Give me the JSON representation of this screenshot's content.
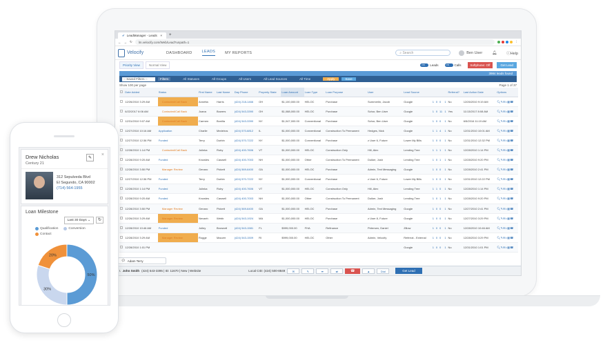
{
  "browser": {
    "tab_title": "LeadManager - Leads",
    "url": "lm.velocify.com/Web/Lead?unpath=1"
  },
  "app": {
    "logo": "Velocify",
    "nav": [
      {
        "label": "DASHBOARD"
      },
      {
        "label": "LEADS"
      },
      {
        "label": "MY REPORTS"
      }
    ],
    "search_placeholder": "Search",
    "user": "Ben User",
    "help": "Help"
  },
  "toolbar": {
    "priority_view": "Priority View",
    "normal_view": "Normal View",
    "leads_toggle": "Leads",
    "calls_toggle": "Calls",
    "softphone": "Softphone: Off",
    "get_lead": "Get Lead"
  },
  "banner": {
    "text": "3984 leads found"
  },
  "filters": {
    "saved": "-- Saved Filters --",
    "filter_btn": "Filters",
    "items": [
      "All Statuses",
      "All Groups",
      "All Users",
      "All Lead Sources",
      "All Time"
    ],
    "apply": "Apply",
    "save": "Save"
  },
  "meta": {
    "show": "Show 100 per page",
    "page": "Page 1 of 37"
  },
  "table": {
    "headers": [
      "Date Added",
      "Status",
      "First Name",
      "Last Name",
      "Day Phone",
      "Property State",
      "Loan Amount",
      "Loan Type",
      "Loan Purpose",
      "User",
      "Lead Source",
      "",
      "",
      "",
      "",
      "Referral?",
      "Last Action Date",
      "Options"
    ],
    "rows": [
      [
        "12/26/2010 3:29 AM",
        "Contacted/Call Back",
        "Annetta",
        "Harris",
        "(424) 218-1466",
        "OH",
        "$1,100,000.00",
        "HELOC",
        "Purchase",
        "Summerlin, Jacob",
        "Google",
        "1",
        "0",
        "0",
        "1",
        "No",
        "12/26/2010 9:19 AM"
      ],
      [
        "6/22/2017 6:06 AM",
        "Contacted/Call Back",
        "Joana",
        "Bowers",
        "(424) 543-3390",
        "OH",
        "$1,088,000.00",
        "HELOC",
        "Purchase",
        "Schor, Ben User",
        "Google",
        "1",
        "0",
        "11",
        "1",
        "Yes",
        "11/13/2017 8:08 AM"
      ],
      [
        "12/31/2010 9:07 AM",
        "Contacted/Call Back",
        "Carmen",
        "Bonilla",
        "(424) 543-3390",
        "NY",
        "$1,047,000.00",
        "Conventional",
        "Purchase",
        "Schor, Ben User",
        "Google",
        "1",
        "0",
        "0",
        "1",
        "No",
        "6/5/2016 11:19 AM"
      ],
      [
        "12/27/2010 10:16 AM",
        "Application",
        "Charlie",
        "Medeiros",
        "(424) 570-6812",
        "IL",
        "$1,000,000.00",
        "Conventional",
        "Construction To Permanent",
        "Hedges, Nick",
        "Google",
        "1",
        "1",
        "4",
        "1",
        "No",
        "12/31/2010 10:01 AM"
      ],
      [
        "12/27/2010 12:36 PM",
        "Funded",
        "Terry",
        "Durbin",
        "(424) 570-7222",
        "NY",
        "$1,000,000.00",
        "Conventional",
        "Purchase",
        "z User 6, Future",
        "Lower My Bills",
        "1",
        "0",
        "0",
        "1",
        "No",
        "12/31/2010 12:32 PM"
      ],
      [
        "12/28/2010 1:14 PM",
        "Contacted/Call Back",
        "Julinka",
        "Ruby",
        "(424) 400-7606",
        "VT",
        "$1,000,000.00",
        "HELOC",
        "Construction Only",
        "Hill, Alex",
        "Lending Tree",
        "1",
        "1",
        "1",
        "1",
        "No",
        "12/28/2010 1:14 PM"
      ],
      [
        "12/28/2010 9:20 AM",
        "Funded",
        "Knowles",
        "Caswell",
        "(424) 400-7003",
        "NH",
        "$1,000,000.00",
        "Other",
        "Construction To Permanent",
        "Duiker, Josh",
        "Lending Tree",
        "1",
        "0",
        "1",
        "1",
        "No",
        "12/28/2010 9:20 PM"
      ],
      [
        "12/28/2010 3:50 PM",
        "Manager Review",
        "Genaro",
        "Pickett",
        "(424) 569-6400",
        "GA",
        "$1,000,000.00",
        "HELOC",
        "Purchase",
        "Admin, Text Messaging",
        "Google",
        "1",
        "0",
        "0",
        "1",
        "No",
        "12/28/2010 2:41 PM"
      ],
      [
        "12/27/2010 12:36 PM",
        "Funded",
        "Terry",
        "Durbin",
        "(424) 570-7222",
        "NY",
        "$1,000,000.00",
        "Conventional",
        "Purchase",
        "z User 6, Future",
        "Lower My Bills",
        "1",
        "0",
        "0",
        "1",
        "No",
        "12/31/2010 12:22 PM"
      ],
      [
        "12/28/2010 1:14 PM",
        "Funded",
        "Julinka",
        "Ruby",
        "(424) 400-7606",
        "VT",
        "$1,000,000.00",
        "HELOC",
        "Construction Only",
        "Hill, Alex",
        "Lending Tree",
        "1",
        "1",
        "0",
        "1",
        "No",
        "12/28/2010 1:14 PM"
      ],
      [
        "12/28/2010 9:20 AM",
        "Funded",
        "Knowles",
        "Caswell",
        "(424) 400-7003",
        "NH",
        "$1,000,000.00",
        "Other",
        "Construction To Permanent",
        "Duiker, Josh",
        "Lending Tree",
        "1",
        "0",
        "1",
        "1",
        "No",
        "12/28/2010 9:20 PM"
      ],
      [
        "12/28/2010 3:50 PM",
        "Manager Review",
        "Genaro",
        "Pickett",
        "(424) 569-6400",
        "GA",
        "$1,000,000.00",
        "HELOC",
        "Purchase",
        "Admin, Text Messaging",
        "Google",
        "1",
        "0",
        "0",
        "1",
        "No",
        "12/27/2010 2:41 PM"
      ],
      [
        "12/26/2010 3:29 AM",
        "Manager Review",
        "Nevaeh",
        "Webb",
        "(424) 543-1924",
        "MA",
        "$1,000,000.00",
        "HELOC",
        "Purchase",
        "z User 8, Future",
        "Google",
        "1",
        "0",
        "0",
        "1",
        "No",
        "12/27/2010 3:29 PM"
      ],
      [
        "12/28/2010 10:46 AM",
        "Funded",
        "Jolley",
        "Brownell",
        "(424) 543-1581",
        "FL",
        "$999,000.00",
        "FHA",
        "Refinance",
        "Petersen, Daniel",
        "Zillow",
        "1",
        "0",
        "0",
        "1",
        "No",
        "12/28/2010 10:46 AM"
      ],
      [
        "12/28/2010 3:29 AM",
        "Manager Review",
        "Rogge",
        "Mauver",
        "(424) 543-1509",
        "RI",
        "$999,000.00",
        "HELOC",
        "Other",
        "Admin, Velocify",
        "Referral - External",
        "1",
        "0",
        "0",
        "1",
        "No",
        "12/28/2010 3:29 PM"
      ],
      [
        "12/28/2010 1:01 PM",
        "",
        "",
        "",
        "",
        "",
        "",
        "",
        "",
        "",
        "Google",
        "1",
        "0",
        "0",
        "1",
        "No",
        "12/31/2010 1:01 PM"
      ]
    ]
  },
  "callbar": {
    "contact": "John Smith",
    "details": "(424) 543-3395 | ID: 11670 | New | Website",
    "local": "Local CID: (424) 500-8849",
    "get_lead": "Get Lead",
    "dial": "Dial"
  },
  "chat": {
    "name": "Adam Terry"
  },
  "mobile": {
    "name": "Drew Nicholas",
    "company": "Century 21",
    "street": "312 Sepulveda Blvd",
    "city": "El Segundo, CA 90002",
    "phone": "(714) 564-1955",
    "milestone_title": "Loan Milestone",
    "range": "Last 30 Days",
    "legend": [
      {
        "label": "Qualification",
        "color": "#5b9bd5"
      },
      {
        "label": "Conversion",
        "color": "#b7c9e6"
      },
      {
        "label": "Contact",
        "color": "#f0913a"
      }
    ],
    "chart_data": {
      "type": "pie",
      "categories": [
        "Qualification",
        "Conversion",
        "Contact"
      ],
      "values": [
        50,
        30,
        20
      ],
      "labels": [
        "50%",
        "30%",
        "20%"
      ],
      "colors": [
        "#5b9bd5",
        "#c9d7ee",
        "#f0913a"
      ]
    }
  }
}
